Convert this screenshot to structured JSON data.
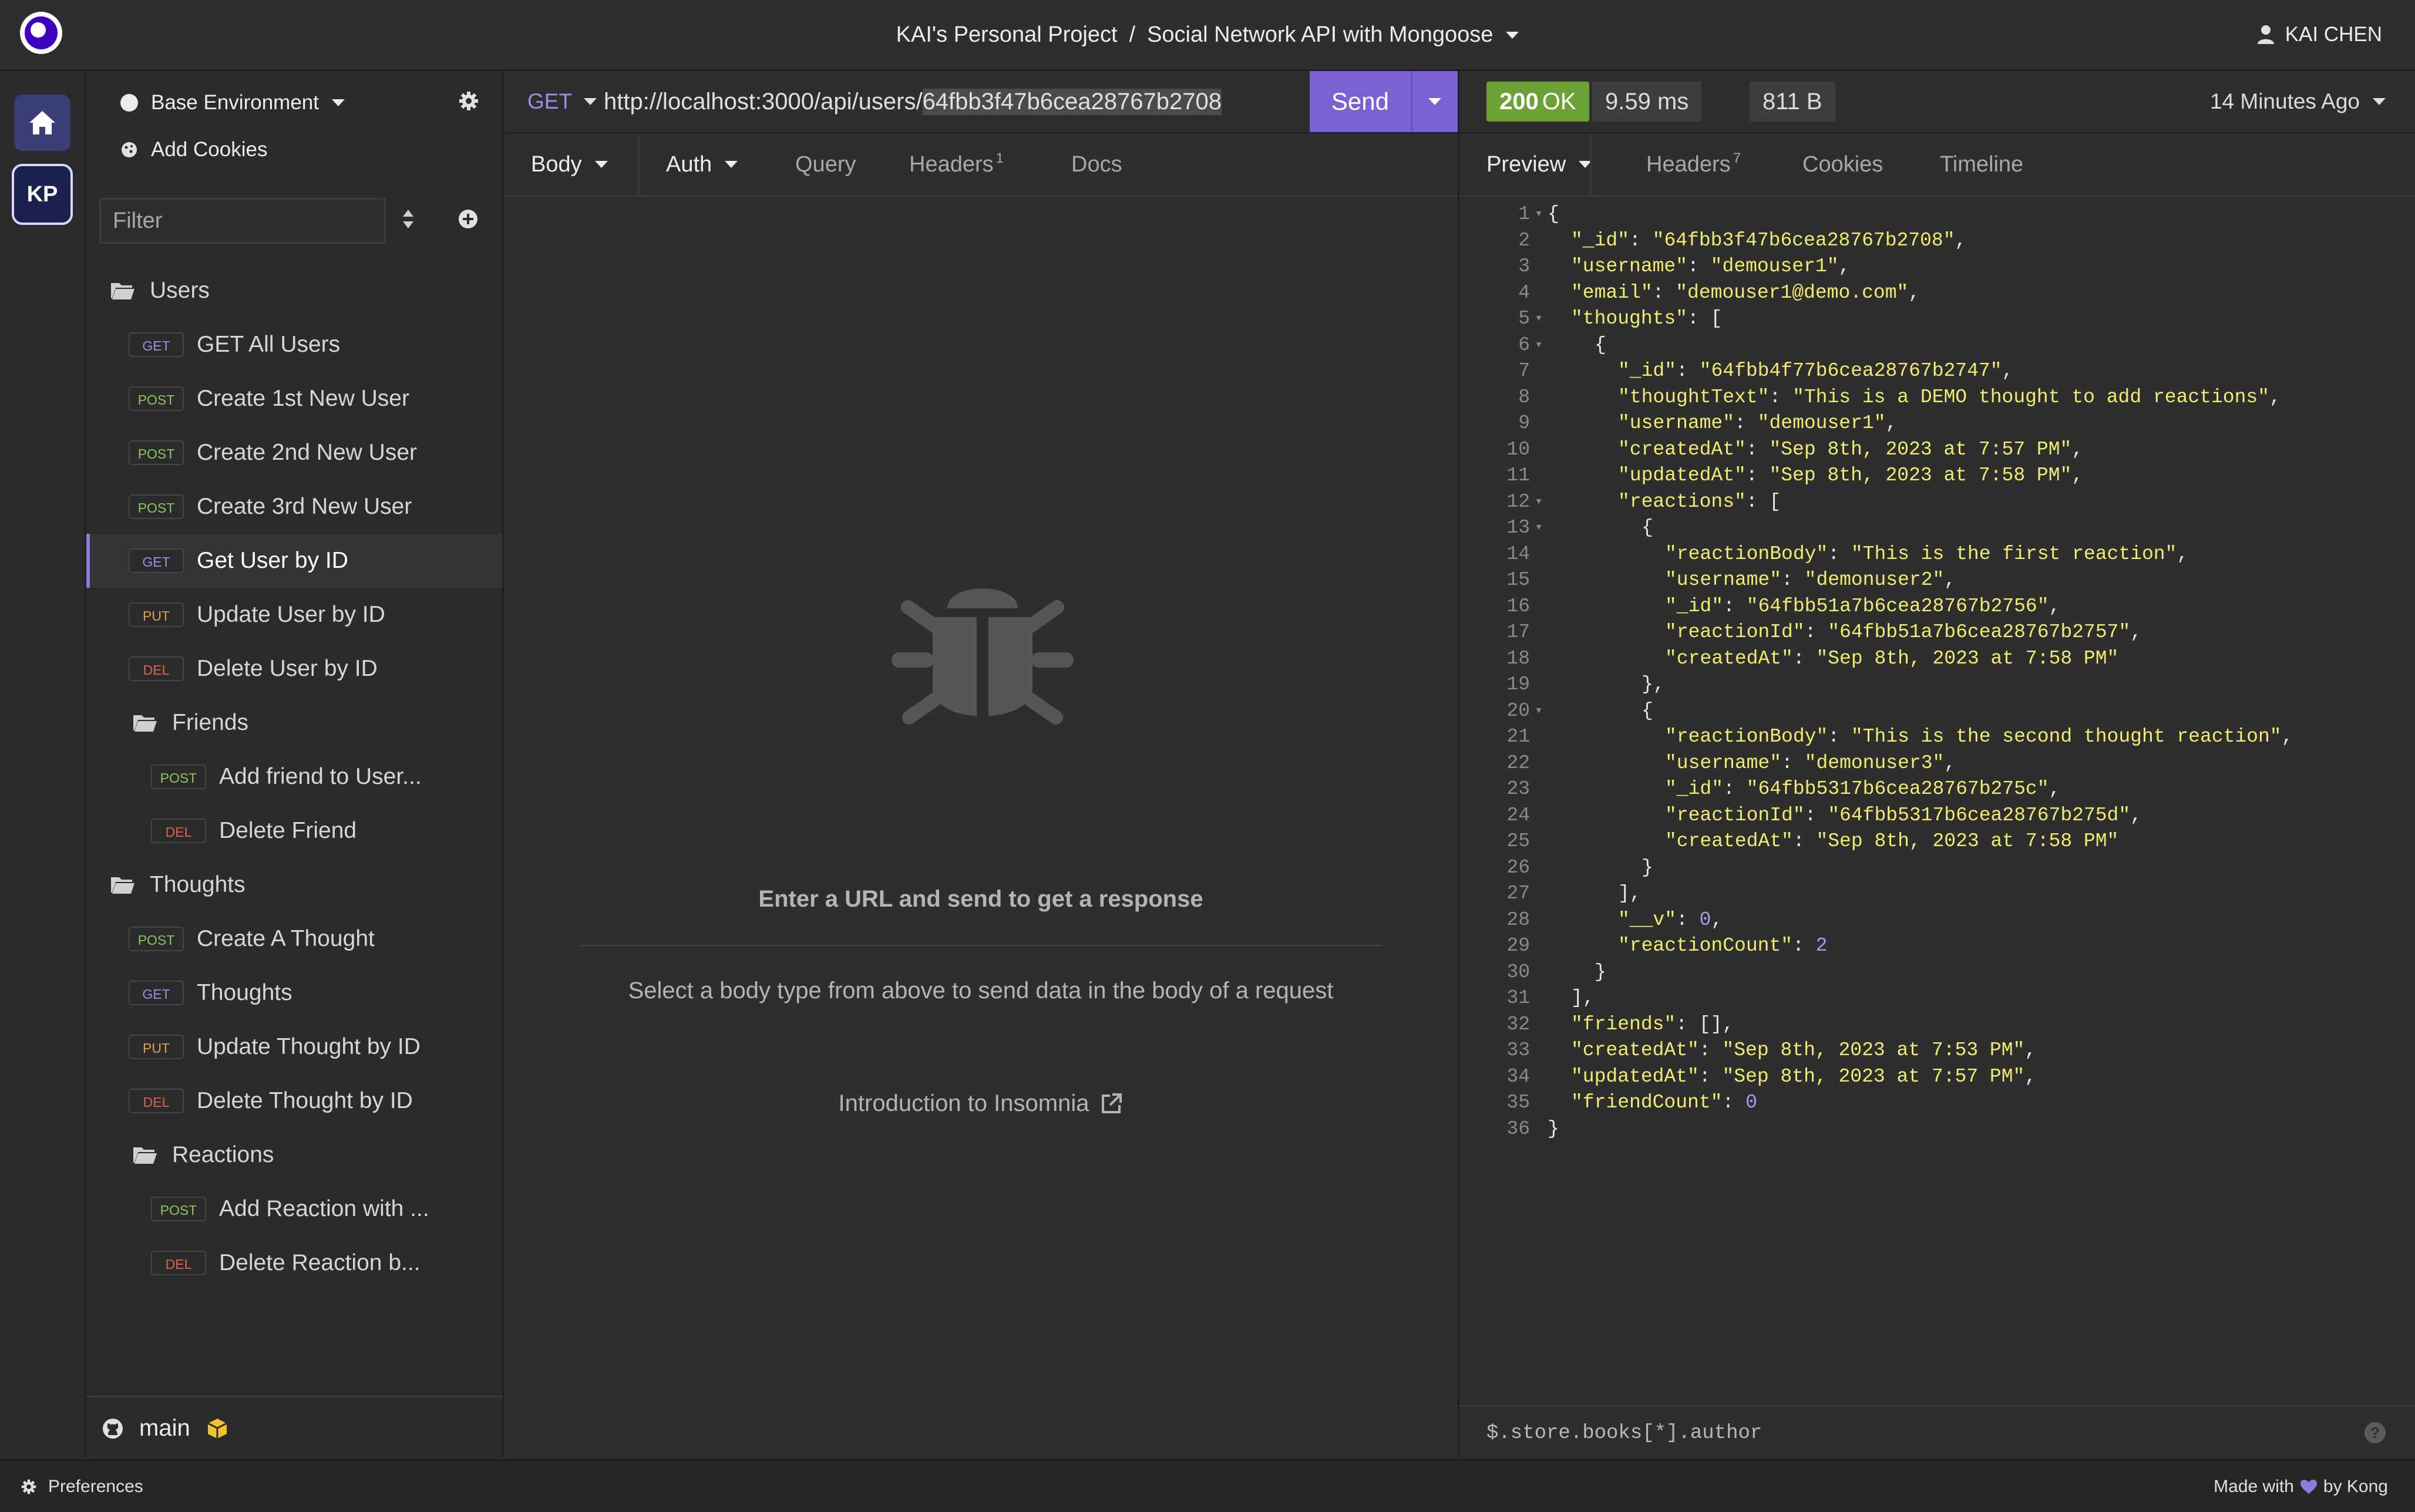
{
  "titlebar": {
    "project": "KAI's Personal Project",
    "separator": "/",
    "collection": "Social Network API with Mongoose",
    "user": "KAI CHEN"
  },
  "rail": {
    "workspace_initials": "KP"
  },
  "sidebar": {
    "environment": "Base Environment",
    "add_cookies": "Add Cookies",
    "filter_placeholder": "Filter",
    "tree": [
      {
        "type": "folder",
        "label": "Users",
        "level": 0
      },
      {
        "type": "request",
        "method": "GET",
        "label": "GET All Users",
        "level": 0
      },
      {
        "type": "request",
        "method": "POST",
        "label": "Create 1st New User",
        "level": 0
      },
      {
        "type": "request",
        "method": "POST",
        "label": "Create 2nd New User",
        "level": 0
      },
      {
        "type": "request",
        "method": "POST",
        "label": "Create 3rd New User",
        "level": 0
      },
      {
        "type": "request",
        "method": "GET",
        "label": "Get User by ID",
        "level": 0,
        "active": true
      },
      {
        "type": "request",
        "method": "PUT",
        "label": "Update User by ID",
        "level": 0
      },
      {
        "type": "request",
        "method": "DEL",
        "label": "Delete User by ID",
        "level": 0
      },
      {
        "type": "folder",
        "label": "Friends",
        "level": 1
      },
      {
        "type": "request",
        "method": "POST",
        "label": "Add friend to User...",
        "level": 1
      },
      {
        "type": "request",
        "method": "DEL",
        "label": "Delete Friend",
        "level": 1
      },
      {
        "type": "folder",
        "label": "Thoughts",
        "level": 0
      },
      {
        "type": "request",
        "method": "POST",
        "label": "Create A Thought",
        "level": 0
      },
      {
        "type": "request",
        "method": "GET",
        "label": "Thoughts",
        "level": 0
      },
      {
        "type": "request",
        "method": "PUT",
        "label": "Update Thought by ID",
        "level": 0
      },
      {
        "type": "request",
        "method": "DEL",
        "label": "Delete Thought by ID",
        "level": 0
      },
      {
        "type": "folder",
        "label": "Reactions",
        "level": 1
      },
      {
        "type": "request",
        "method": "POST",
        "label": "Add Reaction with ...",
        "level": 1
      },
      {
        "type": "request",
        "method": "DEL",
        "label": "Delete Reaction b...",
        "level": 1
      }
    ],
    "branch": "main"
  },
  "request": {
    "method": "GET",
    "url_prefix": "http://localhost:3000/api/users/",
    "url_selected": "64fbb3f47b6cea28767b2708",
    "send_label": "Send",
    "tabs": {
      "body": "Body",
      "auth": "Auth",
      "query": "Query",
      "headers": "Headers",
      "headers_count": "1",
      "docs": "Docs"
    },
    "empty_title": "Enter a URL and send to get a response",
    "empty_hint": "Select a body type from above to send data in the body of a request",
    "intro_link": "Introduction to Insomnia"
  },
  "response": {
    "status_code": "200",
    "status_text": "OK",
    "time": "9.59 ms",
    "size": "811 B",
    "ago": "14 Minutes Ago",
    "tabs": {
      "preview": "Preview",
      "headers": "Headers",
      "headers_count": "7",
      "cookies": "Cookies",
      "timeline": "Timeline"
    },
    "query_placeholder": "$.store.books[*].author",
    "body_lines": [
      [
        {
          "t": "p",
          "v": "{"
        }
      ],
      [
        {
          "t": "k",
          "v": "\"_id\""
        },
        {
          "t": "p",
          "v": ": "
        },
        {
          "t": "s",
          "v": "\"64fbb3f47b6cea28767b2708\""
        },
        {
          "t": "p",
          "v": ","
        }
      ],
      [
        {
          "t": "k",
          "v": "\"username\""
        },
        {
          "t": "p",
          "v": ": "
        },
        {
          "t": "s",
          "v": "\"demouser1\""
        },
        {
          "t": "p",
          "v": ","
        }
      ],
      [
        {
          "t": "k",
          "v": "\"email\""
        },
        {
          "t": "p",
          "v": ": "
        },
        {
          "t": "s",
          "v": "\"demouser1@demo.com\""
        },
        {
          "t": "p",
          "v": ","
        }
      ],
      [
        {
          "t": "k",
          "v": "\"thoughts\""
        },
        {
          "t": "p",
          "v": ": ["
        }
      ],
      [
        {
          "t": "p",
          "v": "{"
        }
      ],
      [
        {
          "t": "k",
          "v": "\"_id\""
        },
        {
          "t": "p",
          "v": ": "
        },
        {
          "t": "s",
          "v": "\"64fbb4f77b6cea28767b2747\""
        },
        {
          "t": "p",
          "v": ","
        }
      ],
      [
        {
          "t": "k",
          "v": "\"thoughtText\""
        },
        {
          "t": "p",
          "v": ": "
        },
        {
          "t": "s",
          "v": "\"This is a DEMO thought to add reactions\""
        },
        {
          "t": "p",
          "v": ","
        }
      ],
      [
        {
          "t": "k",
          "v": "\"username\""
        },
        {
          "t": "p",
          "v": ": "
        },
        {
          "t": "s",
          "v": "\"demouser1\""
        },
        {
          "t": "p",
          "v": ","
        }
      ],
      [
        {
          "t": "k",
          "v": "\"createdAt\""
        },
        {
          "t": "p",
          "v": ": "
        },
        {
          "t": "s",
          "v": "\"Sep 8th, 2023 at 7:57 PM\""
        },
        {
          "t": "p",
          "v": ","
        }
      ],
      [
        {
          "t": "k",
          "v": "\"updatedAt\""
        },
        {
          "t": "p",
          "v": ": "
        },
        {
          "t": "s",
          "v": "\"Sep 8th, 2023 at 7:58 PM\""
        },
        {
          "t": "p",
          "v": ","
        }
      ],
      [
        {
          "t": "k",
          "v": "\"reactions\""
        },
        {
          "t": "p",
          "v": ": ["
        }
      ],
      [
        {
          "t": "p",
          "v": "{"
        }
      ],
      [
        {
          "t": "k",
          "v": "\"reactionBody\""
        },
        {
          "t": "p",
          "v": ": "
        },
        {
          "t": "s",
          "v": "\"This is the first reaction\""
        },
        {
          "t": "p",
          "v": ","
        }
      ],
      [
        {
          "t": "k",
          "v": "\"username\""
        },
        {
          "t": "p",
          "v": ": "
        },
        {
          "t": "s",
          "v": "\"demonuser2\""
        },
        {
          "t": "p",
          "v": ","
        }
      ],
      [
        {
          "t": "k",
          "v": "\"_id\""
        },
        {
          "t": "p",
          "v": ": "
        },
        {
          "t": "s",
          "v": "\"64fbb51a7b6cea28767b2756\""
        },
        {
          "t": "p",
          "v": ","
        }
      ],
      [
        {
          "t": "k",
          "v": "\"reactionId\""
        },
        {
          "t": "p",
          "v": ": "
        },
        {
          "t": "s",
          "v": "\"64fbb51a7b6cea28767b2757\""
        },
        {
          "t": "p",
          "v": ","
        }
      ],
      [
        {
          "t": "k",
          "v": "\"createdAt\""
        },
        {
          "t": "p",
          "v": ": "
        },
        {
          "t": "s",
          "v": "\"Sep 8th, 2023 at 7:58 PM\""
        }
      ],
      [
        {
          "t": "p",
          "v": "},"
        }
      ],
      [
        {
          "t": "p",
          "v": "{"
        }
      ],
      [
        {
          "t": "k",
          "v": "\"reactionBody\""
        },
        {
          "t": "p",
          "v": ": "
        },
        {
          "t": "s",
          "v": "\"This is the second thought reaction\""
        },
        {
          "t": "p",
          "v": ","
        }
      ],
      [
        {
          "t": "k",
          "v": "\"username\""
        },
        {
          "t": "p",
          "v": ": "
        },
        {
          "t": "s",
          "v": "\"demonuser3\""
        },
        {
          "t": "p",
          "v": ","
        }
      ],
      [
        {
          "t": "k",
          "v": "\"_id\""
        },
        {
          "t": "p",
          "v": ": "
        },
        {
          "t": "s",
          "v": "\"64fbb5317b6cea28767b275c\""
        },
        {
          "t": "p",
          "v": ","
        }
      ],
      [
        {
          "t": "k",
          "v": "\"reactionId\""
        },
        {
          "t": "p",
          "v": ": "
        },
        {
          "t": "s",
          "v": "\"64fbb5317b6cea28767b275d\""
        },
        {
          "t": "p",
          "v": ","
        }
      ],
      [
        {
          "t": "k",
          "v": "\"createdAt\""
        },
        {
          "t": "p",
          "v": ": "
        },
        {
          "t": "s",
          "v": "\"Sep 8th, 2023 at 7:58 PM\""
        }
      ],
      [
        {
          "t": "p",
          "v": "}"
        }
      ],
      [
        {
          "t": "p",
          "v": "],"
        }
      ],
      [
        {
          "t": "k",
          "v": "\"__v\""
        },
        {
          "t": "p",
          "v": ": "
        },
        {
          "t": "n",
          "v": "0"
        },
        {
          "t": "p",
          "v": ","
        }
      ],
      [
        {
          "t": "k",
          "v": "\"reactionCount\""
        },
        {
          "t": "p",
          "v": ": "
        },
        {
          "t": "n",
          "v": "2"
        }
      ],
      [
        {
          "t": "p",
          "v": "}"
        }
      ],
      [
        {
          "t": "p",
          "v": "],"
        }
      ],
      [
        {
          "t": "k",
          "v": "\"friends\""
        },
        {
          "t": "p",
          "v": ": [],"
        }
      ],
      [
        {
          "t": "k",
          "v": "\"createdAt\""
        },
        {
          "t": "p",
          "v": ": "
        },
        {
          "t": "s",
          "v": "\"Sep 8th, 2023 at 7:53 PM\""
        },
        {
          "t": "p",
          "v": ","
        }
      ],
      [
        {
          "t": "k",
          "v": "\"updatedAt\""
        },
        {
          "t": "p",
          "v": ": "
        },
        {
          "t": "s",
          "v": "\"Sep 8th, 2023 at 7:57 PM\""
        },
        {
          "t": "p",
          "v": ","
        }
      ],
      [
        {
          "t": "k",
          "v": "\"friendCount\""
        },
        {
          "t": "p",
          "v": ": "
        },
        {
          "t": "n",
          "v": "0"
        }
      ],
      [
        {
          "t": "p",
          "v": "}"
        }
      ]
    ],
    "indent_levels": [
      0,
      1,
      1,
      1,
      1,
      2,
      3,
      3,
      3,
      3,
      3,
      3,
      4,
      5,
      5,
      5,
      5,
      5,
      4,
      4,
      5,
      5,
      5,
      5,
      5,
      4,
      3,
      3,
      3,
      2,
      1,
      1,
      1,
      1,
      1,
      0
    ],
    "foldable_lines": [
      1,
      5,
      6,
      12,
      13,
      20
    ]
  },
  "statusbar": {
    "preferences": "Preferences",
    "made_with": "Made with",
    "by": "by Kong"
  },
  "colors": {
    "accent": "#7a62d4",
    "status_ok": "#6ca235",
    "json_key": "#f0ec6f",
    "json_number": "#a89bf0"
  },
  "icons": [
    "app-logo",
    "home-icon",
    "gear-icon",
    "cookie-icon",
    "sort-icon",
    "plus-circle-icon",
    "folder-icon",
    "github-icon",
    "cube-icon",
    "bug-icon",
    "external-link-icon",
    "user-icon",
    "help-icon",
    "heart-icon"
  ]
}
